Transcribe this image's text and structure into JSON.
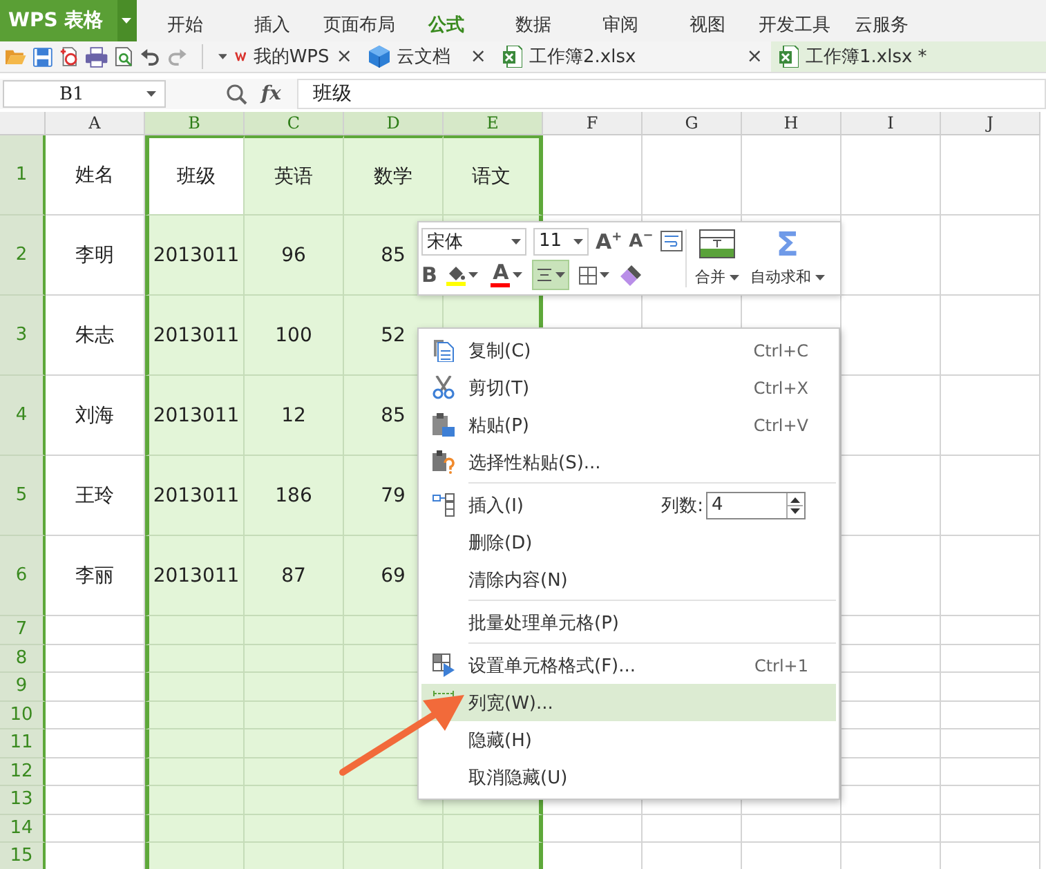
{
  "app_button": {
    "label": "WPS 表格"
  },
  "ribbon_tabs": [
    {
      "label": "开始",
      "selected": false
    },
    {
      "label": "插入",
      "selected": false
    },
    {
      "label": "页面布局",
      "selected": false
    },
    {
      "label": "公式",
      "selected": true
    },
    {
      "label": "数据",
      "selected": false
    },
    {
      "label": "审阅",
      "selected": false
    },
    {
      "label": "视图",
      "selected": false
    },
    {
      "label": "开发工具",
      "selected": false
    },
    {
      "label": "云服务",
      "selected": false
    }
  ],
  "doc_tabs": [
    {
      "label": "我的WPS",
      "close": "×",
      "selected": false
    },
    {
      "label": "云文档",
      "close": "×",
      "selected": false
    },
    {
      "label": "工作簿2.xlsx",
      "close": "×",
      "selected": false
    },
    {
      "label": "工作簿1.xlsx *",
      "selected": true
    }
  ],
  "formula_bar": {
    "cell_ref": "B1",
    "fx": "fx",
    "value": "班级"
  },
  "sheet": {
    "columns": [
      {
        "label": "A",
        "selected": false
      },
      {
        "label": "B",
        "selected": true
      },
      {
        "label": "C",
        "selected": true
      },
      {
        "label": "D",
        "selected": true
      },
      {
        "label": "E",
        "selected": true
      },
      {
        "label": "F",
        "selected": false
      },
      {
        "label": "G",
        "selected": false
      },
      {
        "label": "H",
        "selected": false
      },
      {
        "label": "I",
        "selected": false
      },
      {
        "label": "J",
        "selected": false
      }
    ],
    "rows": [
      {
        "label": "1",
        "cells": [
          {
            "text": "姓名",
            "active": false
          },
          {
            "text": "班级",
            "active": true
          },
          {
            "text": "英语",
            "active": false
          },
          {
            "text": "数学",
            "active": false
          },
          {
            "text": "语文",
            "active": false
          }
        ]
      },
      {
        "label": "2",
        "cells": [
          {
            "text": "李明",
            "active": false
          },
          {
            "text": "2013011",
            "active": false
          },
          {
            "text": "96",
            "active": false
          },
          {
            "text": "85",
            "active": false
          }
        ]
      },
      {
        "label": "3",
        "cells": [
          {
            "text": "朱志",
            "active": false
          },
          {
            "text": "2013011",
            "active": false
          },
          {
            "text": "100",
            "active": false
          },
          {
            "text": "52",
            "active": false
          }
        ]
      },
      {
        "label": "4",
        "cells": [
          {
            "text": "刘海",
            "active": false
          },
          {
            "text": "2013011",
            "active": false
          },
          {
            "text": "12",
            "active": false
          },
          {
            "text": "85",
            "active": false
          }
        ]
      },
      {
        "label": "5",
        "cells": [
          {
            "text": "王玲",
            "active": false
          },
          {
            "text": "2013011",
            "active": false
          },
          {
            "text": "186",
            "active": false
          },
          {
            "text": "79",
            "active": false
          }
        ]
      },
      {
        "label": "6",
        "cells": [
          {
            "text": "李丽",
            "active": false
          },
          {
            "text": "2013011",
            "active": false
          },
          {
            "text": "87",
            "active": false
          },
          {
            "text": "69",
            "active": false
          }
        ]
      },
      {
        "label": "7"
      },
      {
        "label": "8"
      },
      {
        "label": "9"
      },
      {
        "label": "10"
      },
      {
        "label": "11"
      },
      {
        "label": "12"
      },
      {
        "label": "13"
      },
      {
        "label": "14"
      },
      {
        "label": "15"
      }
    ]
  },
  "mini_toolbar": {
    "font": "宋体",
    "size": "11",
    "grow": "A",
    "grow_mark": "+",
    "shrink": "A",
    "shrink_mark": "−",
    "bold": "B",
    "font_color": "A",
    "align_selected": true,
    "merge": "合并",
    "autosum_symbol": "Σ",
    "autosum": "自动求和"
  },
  "context_menu": {
    "items": [
      {
        "kind": "command",
        "label": "复制(C)",
        "shortcut": "Ctrl+C",
        "selected": false
      },
      {
        "kind": "command",
        "label": "剪切(T)",
        "shortcut": "Ctrl+X",
        "selected": false
      },
      {
        "kind": "command",
        "label": "粘贴(P)",
        "shortcut": "Ctrl+V",
        "selected": false
      },
      {
        "kind": "command",
        "label": "选择性粘贴(S)...",
        "selected": false
      },
      {
        "kind": "separator"
      },
      {
        "kind": "insert",
        "label": "插入(I)",
        "count_label": "列数:",
        "count": "4",
        "selected": false
      },
      {
        "kind": "command",
        "label": "删除(D)",
        "selected": false
      },
      {
        "kind": "command",
        "label": "清除内容(N)",
        "selected": false
      },
      {
        "kind": "separator"
      },
      {
        "kind": "command",
        "label": "批量处理单元格(P)",
        "selected": false
      },
      {
        "kind": "separator"
      },
      {
        "kind": "command",
        "label": "设置单元格格式(F)...",
        "shortcut": "Ctrl+1",
        "selected": false
      },
      {
        "kind": "command",
        "label": "列宽(W)...",
        "selected": true
      },
      {
        "kind": "command",
        "label": "隐藏(H)",
        "selected": false
      },
      {
        "kind": "command",
        "label": "取消隐藏(U)",
        "selected": false
      }
    ]
  }
}
